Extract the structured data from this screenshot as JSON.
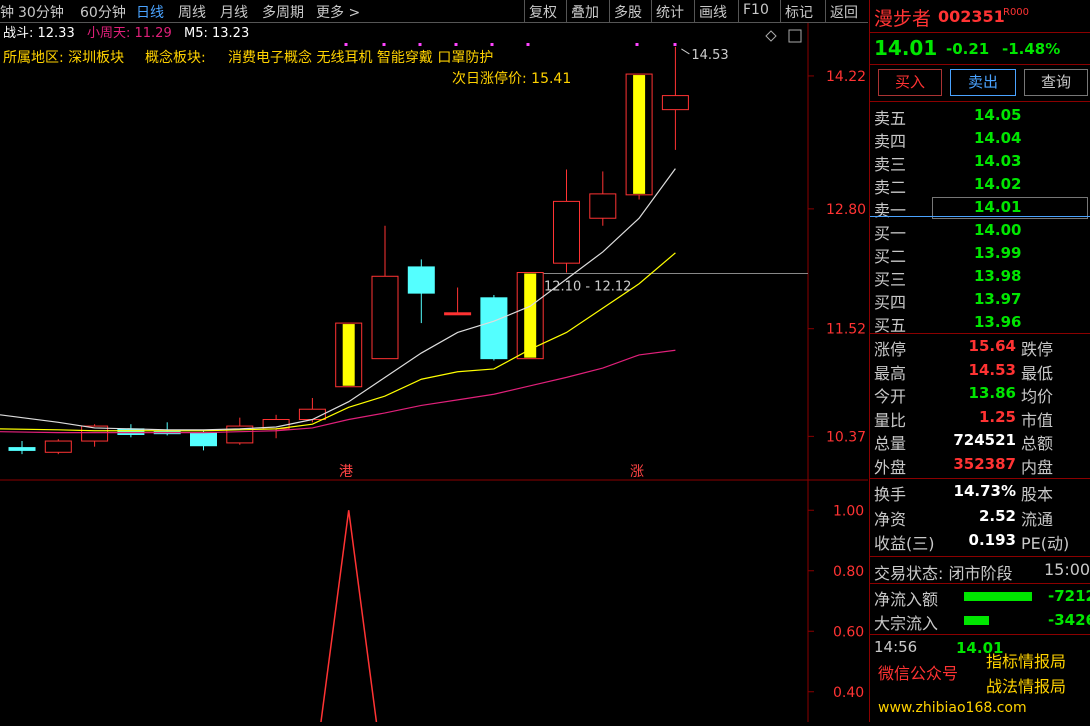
{
  "toolbar": {
    "left_items": [
      "钟",
      "30分钟",
      "60分钟",
      "日线",
      "周线",
      "月线",
      "多周期",
      "更多 >"
    ],
    "active_item": "日线",
    "right_items": [
      "复权",
      "叠加",
      "多股",
      "统计",
      "画线",
      "F10",
      "标记",
      "返回"
    ]
  },
  "indicator_line": {
    "zhandou_label": "战斗: 12.33",
    "xiaozhoutian_label": "小周天: 11.29",
    "m5_label": "M5: 13.23"
  },
  "region_line": {
    "region_label": "所属地区: 深圳板块",
    "concept_label": "概念板块:",
    "concept_items": "消费电子概念 无线耳机 智能穿戴 口罩防护"
  },
  "next_limit": "次日涨停价: 15.41",
  "annotations": {
    "high_note": "14.53",
    "range_note": "12.10 - 12.12",
    "marker_gang": "港",
    "marker_zhang": "涨"
  },
  "price_axis": [
    "14.22",
    "12.80",
    "11.52",
    "10.37"
  ],
  "sub_axis": [
    "1.00",
    "0.80",
    "0.60",
    "0.40"
  ],
  "colors": {
    "up": "#ff3333",
    "down": "#54ffff",
    "yellow": "#ffff00",
    "white": "#dddddd",
    "pink": "#e0207a",
    "green": "#00e600",
    "red": "#ff3333"
  },
  "chart_data": {
    "type": "candlestick",
    "ylim": [
      10.0,
      14.7
    ],
    "candles": [
      {
        "o": 10.25,
        "h": 10.32,
        "l": 10.18,
        "c": 10.22,
        "dir": "down"
      },
      {
        "o": 10.2,
        "h": 10.34,
        "l": 10.18,
        "c": 10.32,
        "dir": "up"
      },
      {
        "o": 10.32,
        "h": 10.5,
        "l": 10.26,
        "c": 10.48,
        "dir": "up"
      },
      {
        "o": 10.45,
        "h": 10.5,
        "l": 10.36,
        "c": 10.39,
        "dir": "down"
      },
      {
        "o": 10.42,
        "h": 10.52,
        "l": 10.38,
        "c": 10.4,
        "dir": "down"
      },
      {
        "o": 10.41,
        "h": 10.44,
        "l": 10.22,
        "c": 10.27,
        "dir": "down"
      },
      {
        "o": 10.3,
        "h": 10.57,
        "l": 10.28,
        "c": 10.48,
        "dir": "up"
      },
      {
        "o": 10.45,
        "h": 10.6,
        "l": 10.35,
        "c": 10.55,
        "dir": "up"
      },
      {
        "o": 10.55,
        "h": 10.78,
        "l": 10.52,
        "c": 10.66,
        "dir": "up"
      },
      {
        "o": 10.9,
        "h": 11.58,
        "l": 10.9,
        "c": 11.58,
        "dir": "up",
        "yellow": true
      },
      {
        "o": 11.2,
        "h": 12.62,
        "l": 11.2,
        "c": 12.08,
        "dir": "up"
      },
      {
        "o": 11.9,
        "h": 12.26,
        "l": 11.58,
        "c": 12.18,
        "dir": "down"
      },
      {
        "o": 11.69,
        "h": 11.96,
        "l": 11.67,
        "c": 11.67,
        "dir": "up",
        "flat": true
      },
      {
        "o": 11.85,
        "h": 11.88,
        "l": 11.18,
        "c": 11.2,
        "dir": "down"
      },
      {
        "o": 11.2,
        "h": 12.12,
        "l": 11.2,
        "c": 12.12,
        "dir": "up",
        "yellow": true
      },
      {
        "o": 12.22,
        "h": 13.22,
        "l": 12.12,
        "c": 12.88,
        "dir": "up"
      },
      {
        "o": 12.7,
        "h": 13.2,
        "l": 12.62,
        "c": 12.96,
        "dir": "up"
      },
      {
        "o": 12.95,
        "h": 14.24,
        "l": 12.9,
        "c": 14.24,
        "dir": "up",
        "yellow": true
      },
      {
        "o": 13.86,
        "h": 14.53,
        "l": 13.43,
        "c": 14.01,
        "dir": "up"
      }
    ],
    "ma_white": [
      10.6,
      10.52,
      10.46,
      10.45,
      10.44,
      10.44,
      10.45,
      10.47,
      10.55,
      10.74,
      11.0,
      11.26,
      11.48,
      11.6,
      11.76,
      12.05,
      12.34,
      12.7,
      13.23
    ],
    "ma_yellow": [
      10.45,
      10.44,
      10.43,
      10.43,
      10.43,
      10.43,
      10.44,
      10.45,
      10.5,
      10.68,
      10.8,
      10.98,
      11.06,
      11.09,
      11.3,
      11.48,
      11.74,
      12.0,
      12.33
    ],
    "ma_pink": [
      10.42,
      10.41,
      10.41,
      10.41,
      10.41,
      10.41,
      10.42,
      10.43,
      10.46,
      10.55,
      10.62,
      10.7,
      10.76,
      10.82,
      10.91,
      11.0,
      11.1,
      11.24,
      11.29
    ],
    "sub_ylim": [
      0.3,
      1.1
    ],
    "sub_values": [
      0,
      0,
      0,
      0,
      0,
      0,
      0,
      0,
      0,
      1.0,
      0,
      0,
      0,
      0,
      0,
      0,
      0,
      0,
      0
    ]
  },
  "side": {
    "name": "漫步者",
    "code": "002351",
    "badge": "R000",
    "price": "14.01",
    "change": "-0.21",
    "pct": "-1.48%",
    "buy_btn": "买入",
    "sell_btn": "卖出",
    "query_btn": "查询",
    "sells": [
      {
        "label": "卖五",
        "price": "14.05"
      },
      {
        "label": "卖四",
        "price": "14.04"
      },
      {
        "label": "卖三",
        "price": "14.03"
      },
      {
        "label": "卖二",
        "price": "14.02"
      },
      {
        "label": "卖一",
        "price": "14.01"
      }
    ],
    "buys": [
      {
        "label": "买一",
        "price": "14.00"
      },
      {
        "label": "买二",
        "price": "13.99"
      },
      {
        "label": "买三",
        "price": "13.98"
      },
      {
        "label": "买四",
        "price": "13.97"
      },
      {
        "label": "买五",
        "price": "13.96"
      }
    ],
    "stats": [
      {
        "l1": "涨停",
        "v": "15.64",
        "c": "red",
        "l2": "跌停"
      },
      {
        "l1": "最高",
        "v": "14.53",
        "c": "red",
        "l2": "最低"
      },
      {
        "l1": "今开",
        "v": "13.86",
        "c": "green",
        "l2": "均价"
      },
      {
        "l1": "量比",
        "v": "1.25",
        "c": "red",
        "l2": "市值"
      },
      {
        "l1": "总量",
        "v": "724521",
        "c": "white",
        "l2": "总额"
      },
      {
        "l1": "外盘",
        "v": "352387",
        "c": "red",
        "l2": "内盘"
      }
    ],
    "stats2": [
      {
        "l1": "换手",
        "v": "14.73%",
        "l2": "股本"
      },
      {
        "l1": "净资",
        "v": "2.52",
        "l2": "流通"
      },
      {
        "l1": "收益(三)",
        "v": "0.193",
        "l2": "PE(动)"
      }
    ],
    "trade_status": "交易状态: 闭市阶段",
    "trade_time": "15:00",
    "flow": [
      {
        "label": "净流入额",
        "value": "-7212"
      },
      {
        "label": "大宗流入",
        "value": "-3426"
      }
    ],
    "ticks": [
      {
        "time": "14:56",
        "price": "14.01"
      }
    ]
  },
  "watermark": {
    "wechat": "微信公众号",
    "brand1": "指标情报局",
    "brand2": "战法情报局",
    "url": "www.zhibiao168.com"
  }
}
